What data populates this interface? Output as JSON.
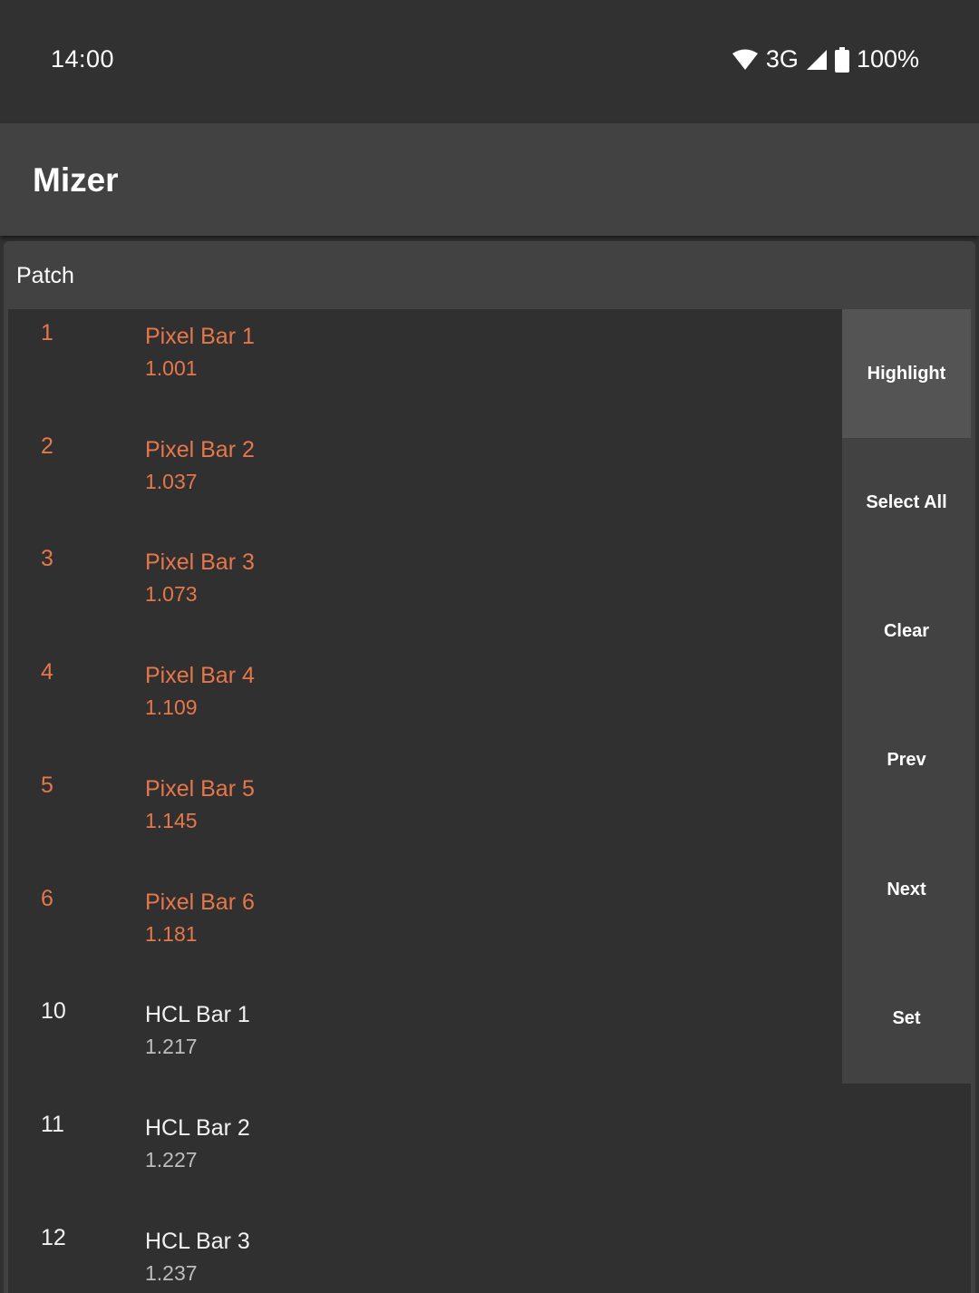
{
  "status_bar": {
    "time": "14:00",
    "network": "3G",
    "battery": "100%",
    "icons": [
      "wifi-icon",
      "signal-icon",
      "battery-icon"
    ]
  },
  "app_bar": {
    "title": "Mizer"
  },
  "panel": {
    "title": "Patch"
  },
  "colors": {
    "selected_text": "#e5774a",
    "background": "#303030",
    "surface": "#424242",
    "active_button": "#545454"
  },
  "fixtures": [
    {
      "id": "1",
      "name": "Pixel Bar 1",
      "address": "1.001",
      "selected": true
    },
    {
      "id": "2",
      "name": "Pixel Bar 2",
      "address": "1.037",
      "selected": true
    },
    {
      "id": "3",
      "name": "Pixel Bar 3",
      "address": "1.073",
      "selected": true
    },
    {
      "id": "4",
      "name": "Pixel Bar 4",
      "address": "1.109",
      "selected": true
    },
    {
      "id": "5",
      "name": "Pixel Bar 5",
      "address": "1.145",
      "selected": true
    },
    {
      "id": "6",
      "name": "Pixel Bar 6",
      "address": "1.181",
      "selected": true
    },
    {
      "id": "10",
      "name": "HCL Bar 1",
      "address": "1.217",
      "selected": false
    },
    {
      "id": "11",
      "name": "HCL Bar 2",
      "address": "1.227",
      "selected": false
    },
    {
      "id": "12",
      "name": "HCL Bar 3",
      "address": "1.237",
      "selected": false
    }
  ],
  "actions": [
    {
      "label": "Highlight",
      "active": true
    },
    {
      "label": "Select All",
      "active": false
    },
    {
      "label": "Clear",
      "active": false
    },
    {
      "label": "Prev",
      "active": false
    },
    {
      "label": "Next",
      "active": false
    },
    {
      "label": "Set",
      "active": false
    }
  ]
}
